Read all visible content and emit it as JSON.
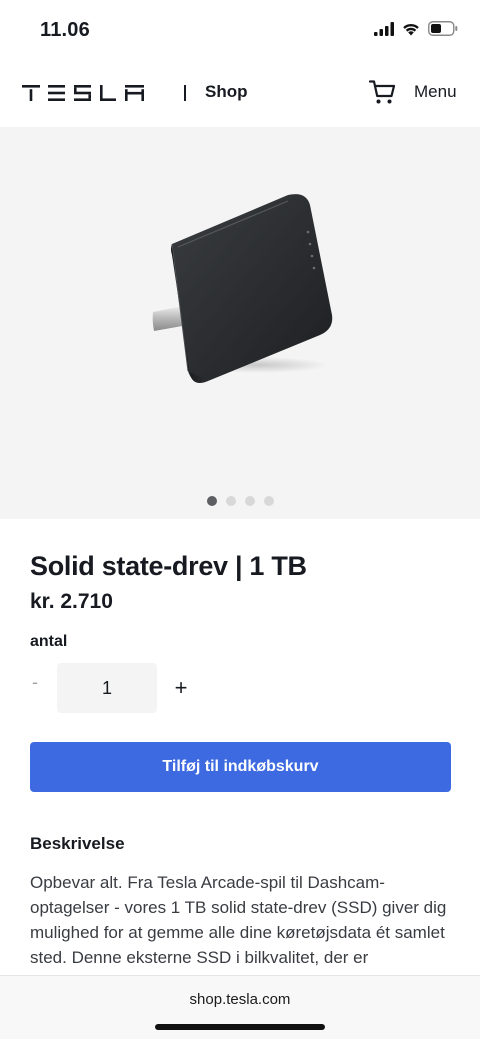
{
  "status_bar": {
    "time": "11.06",
    "icons": [
      "signal-icon",
      "wifi-icon",
      "battery-icon"
    ]
  },
  "header": {
    "logo_text": "TESLA",
    "shop_label": "Shop",
    "cart_icon": "cart-icon",
    "menu_label": "Menu"
  },
  "gallery": {
    "image_subject": "solid-state-drive",
    "slide_count": 4,
    "active_slide": 1
  },
  "product": {
    "title": "Solid state-drev | 1 TB",
    "price": "kr. 2.710"
  },
  "quantity": {
    "label": "antal",
    "minus": "-",
    "value": "1",
    "plus": "+"
  },
  "add_to_cart": {
    "label": "Tilføj til indkøbskurv"
  },
  "description": {
    "heading": "Beskrivelse",
    "text": "Opbevar alt. Fra Tesla Arcade-spil til Dashcam-optagelser - vores 1 TB solid state-drev (SSD) giver dig mulighed for at gemme alle dine køretøjsdata ét samlet sted. Denne eksterne SSD i bilkvalitet, der er"
  },
  "browser": {
    "url": "shop.tesla.com"
  },
  "colors": {
    "accent": "#3e6ae1",
    "text": "#171a20",
    "gallery_bg": "#f4f4f4"
  }
}
